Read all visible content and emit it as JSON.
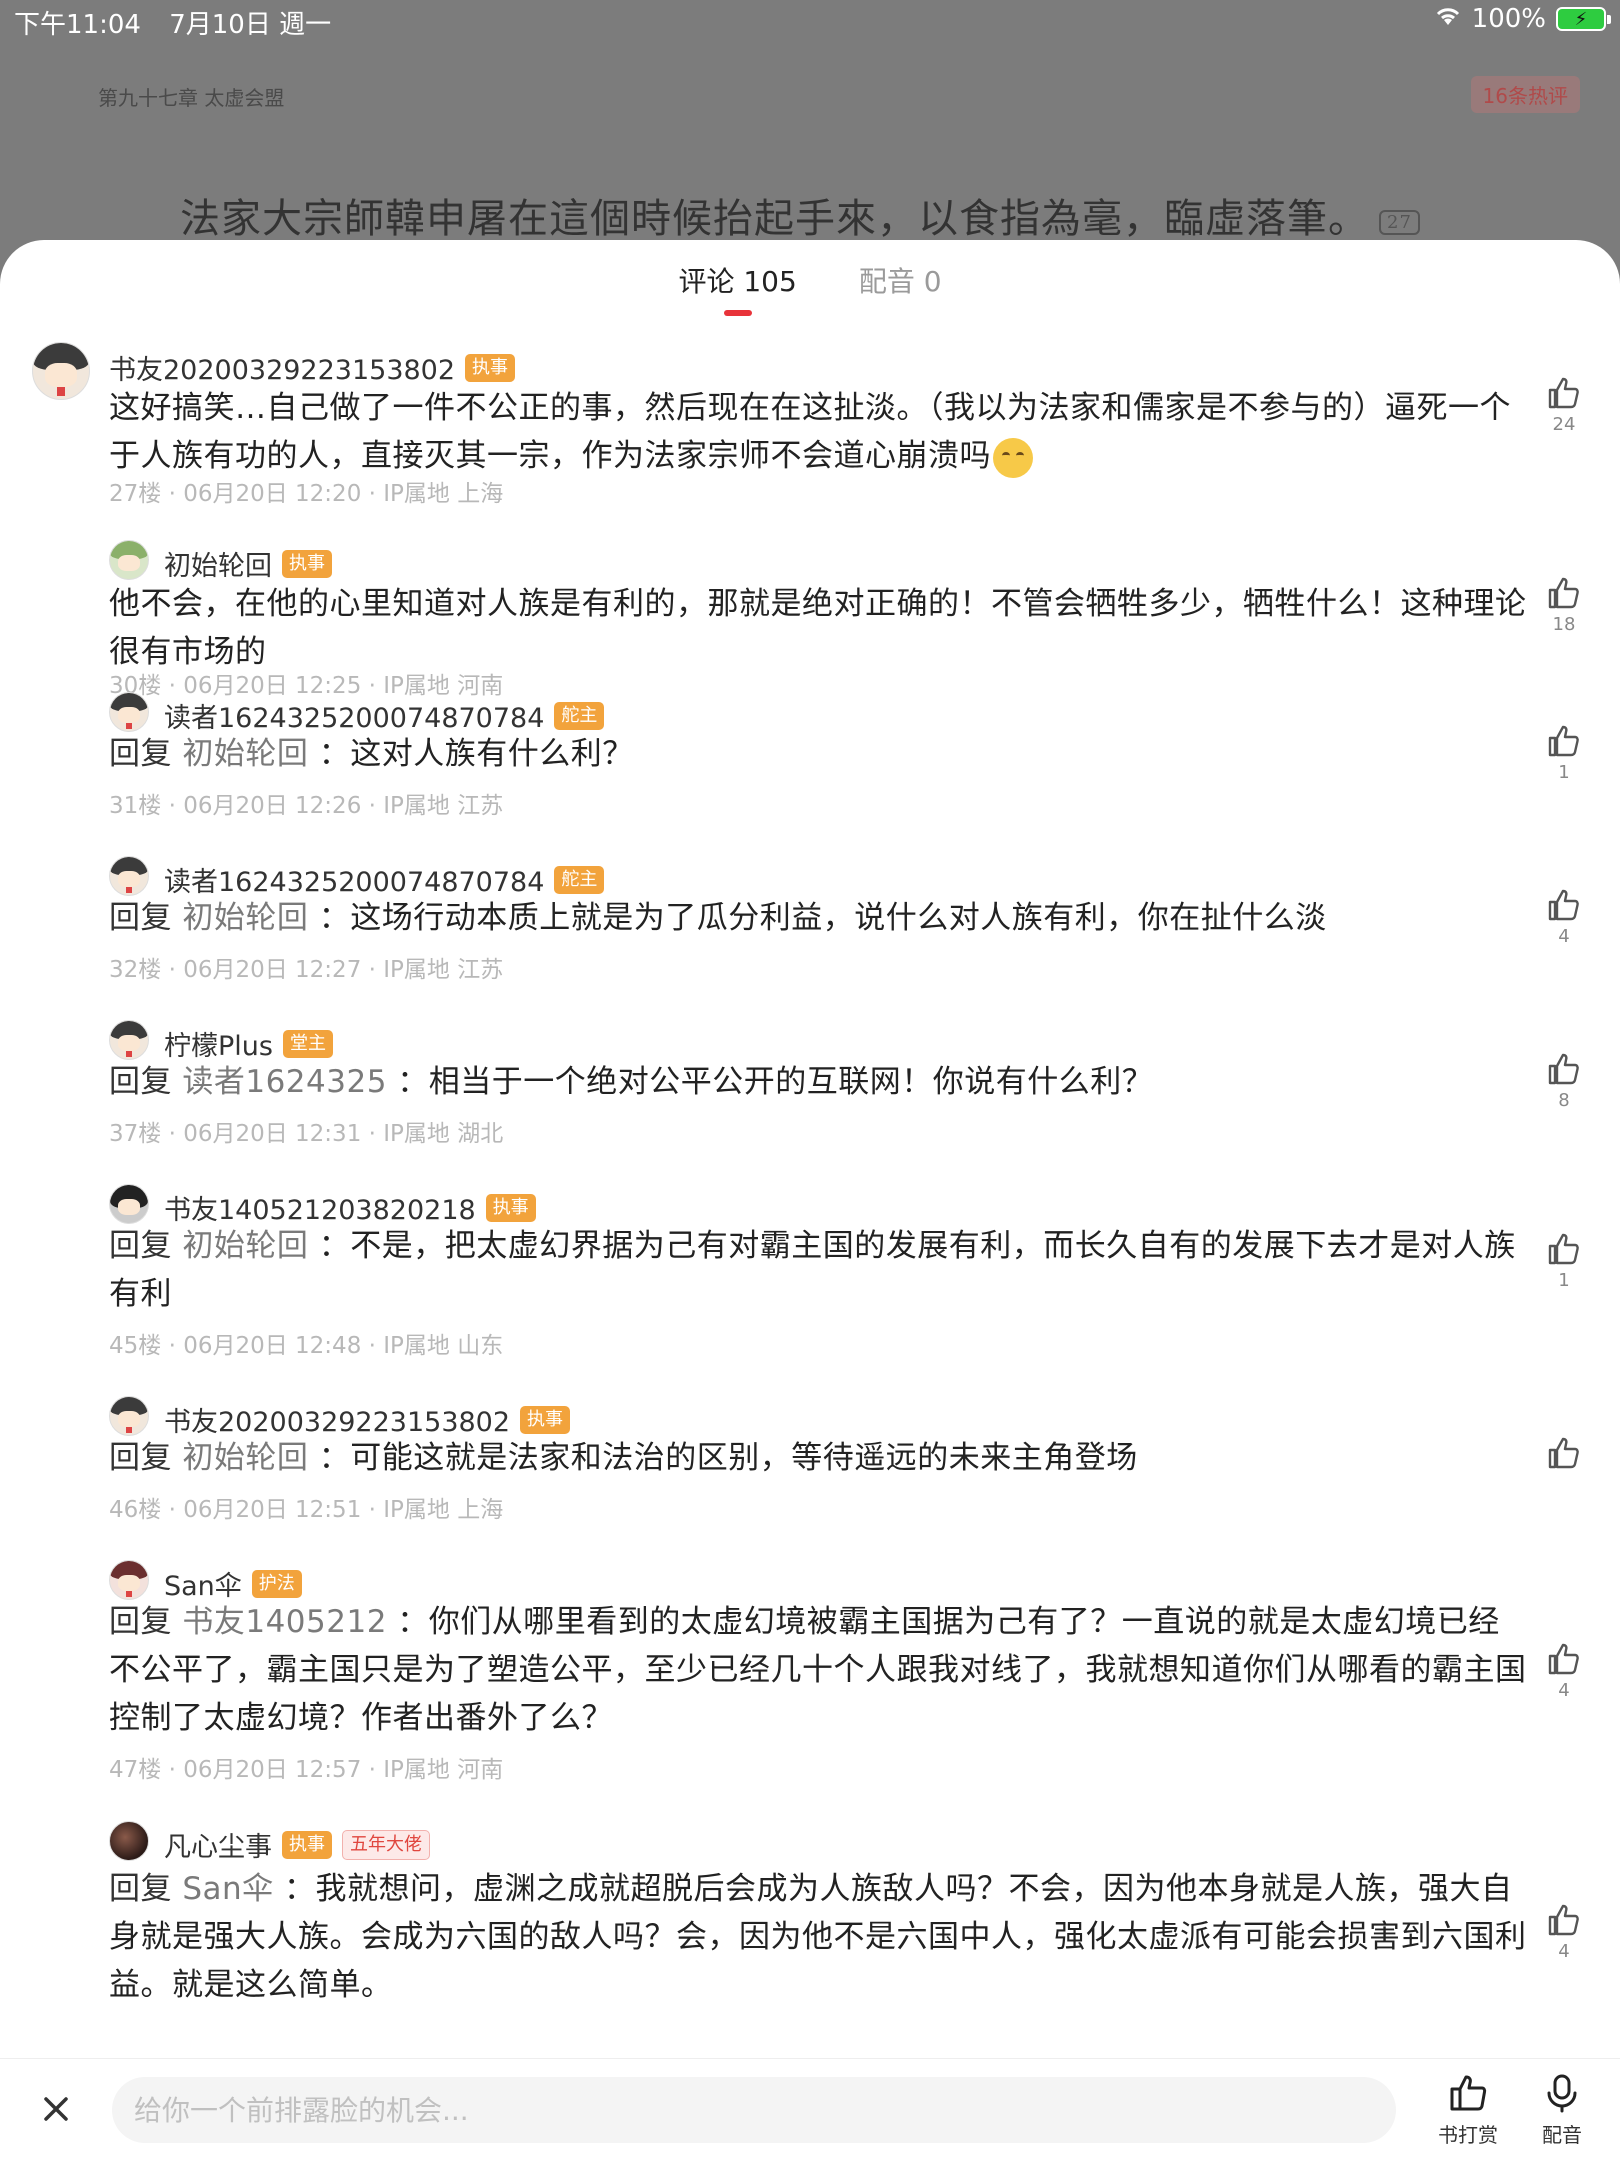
{
  "status": {
    "time": "下午11:04",
    "date": "7月10日 週一",
    "battery": "100%"
  },
  "reader": {
    "chapter_title": "第九十七章 太虚会盟",
    "hot_comments": "16条热评",
    "line_text": "法家大宗師韓申屠在這個時候抬起手來，以食指為毫，臨虛落筆。",
    "line_comment_count": "27"
  },
  "tabs": [
    {
      "label": "评论 105"
    },
    {
      "label": "配音 0"
    }
  ],
  "reply_word": "回复",
  "comments": [
    {
      "user": "书友20200329223153802",
      "badges": [
        "执事"
      ],
      "reply_to": "",
      "text": "这好搞笑…自己做了一件不公正的事，然后现在在这扯淡。（我以为法家和儒家是不参与的）逼死一个于人族有功的人，直接灭其一宗，作为法家宗师不会道心崩溃吗",
      "meta": "27楼 · 06月20日 12:20 · IP属地 上海",
      "likes": "24"
    },
    {
      "user": "初始轮回",
      "badges": [
        "执事"
      ],
      "reply_to": "",
      "text": "他不会，在他的心里知道对人族是有利的，那就是绝对正确的！不管会牺牲多少，牺牲什么！这种理论很有市场的",
      "meta": "30楼 · 06月20日 12:25 · IP属地 河南",
      "likes": "18"
    },
    {
      "user": "读者1624325200074870784",
      "badges": [
        "舵主"
      ],
      "reply_to": "初始轮回",
      "text": "：这对人族有什么利？",
      "meta": "31楼 · 06月20日 12:26 · IP属地 江苏",
      "likes": "1"
    },
    {
      "user": "读者1624325200074870784",
      "badges": [
        "舵主"
      ],
      "reply_to": "初始轮回",
      "text": "：这场行动本质上就是为了瓜分利益，说什么对人族有利，你在扯什么淡",
      "meta": "32楼 · 06月20日 12:27 · IP属地 江苏",
      "likes": "4"
    },
    {
      "user": "柠檬Plus",
      "badges": [
        "堂主"
      ],
      "reply_to": "读者1624325",
      "text": "：相当于一个绝对公平公开的互联网！你说有什么利？",
      "meta": "37楼 · 06月20日 12:31 · IP属地 湖北",
      "likes": "8"
    },
    {
      "user": "书友140521203820218",
      "badges": [
        "执事"
      ],
      "reply_to": "初始轮回",
      "text": "：不是，把太虚幻界据为己有对霸主国的发展有利，而长久自有的发展下去才是对人族有利",
      "meta": "45楼 · 06月20日 12:48 · IP属地 山东",
      "likes": "1"
    },
    {
      "user": "书友20200329223153802",
      "badges": [
        "执事"
      ],
      "reply_to": "初始轮回",
      "text": "：可能这就是法家和法治的区别，等待遥远的未来主角登场",
      "meta": "46楼 · 06月20日 12:51 · IP属地 上海",
      "likes": ""
    },
    {
      "user": "San伞",
      "badges": [
        "护法"
      ],
      "reply_to": "书友1405212",
      "text": "：你们从哪里看到的太虚幻境被霸主国据为己有了？一直说的就是太虚幻境已经不公平了，霸主国只是为了塑造公平，至少已经几十个人跟我对线了，我就想知道你们从哪看的霸主国控制了太虚幻境？作者出番外了么？",
      "meta": "47楼 · 06月20日 12:57 · IP属地 河南",
      "likes": "4"
    },
    {
      "user": "凡心尘事",
      "badges": [
        "执事",
        "五年大佬"
      ],
      "reply_to": "San伞",
      "text": "：我就想问，虚渊之成就超脱后会成为人族敌人吗？不会，因为他本身就是人族，强大自身就是强大人族。会成为六国的敌人吗？会，因为他不是六国中人，强化太虚派有可能会损害到六国利益。就是这么简单。",
      "meta": "",
      "likes": "4"
    }
  ],
  "bottom": {
    "input_placeholder": "给你一个前排露脸的机会...",
    "tip_label": "书打赏",
    "dub_label": "配音"
  },
  "colors": {
    "accent": "#e8333a",
    "badge": "#f2a33c",
    "senior_badge_text": "#e0463e"
  }
}
